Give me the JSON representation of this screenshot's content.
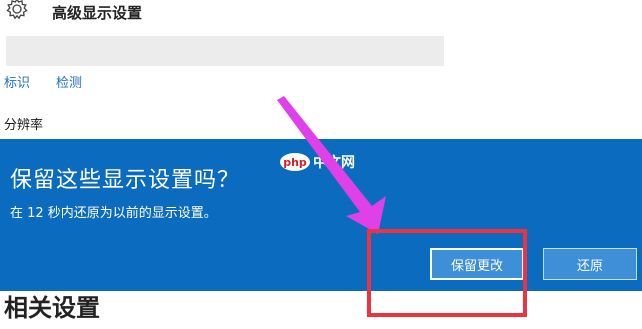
{
  "header": {
    "title": "高级显示设置",
    "icon": "gear-icon"
  },
  "links": {
    "identify": "标识",
    "detect": "检测"
  },
  "resolution_label": "分辨率",
  "related_settings": "相关设置",
  "dialog": {
    "title": "保留这些显示设置吗？",
    "message": "在 12 秒内还原为以前的显示设置。",
    "keep_button": "保留更改",
    "revert_button": "还原"
  },
  "watermark": {
    "logo_text": "php",
    "site_text": "中文网"
  },
  "colors": {
    "dialog_bg": "#0b6bbf",
    "button_bg": "#3d8fd8",
    "link": "#1e6fc9",
    "annotation_arrow": "#e040e8",
    "annotation_box": "#ee3340"
  }
}
